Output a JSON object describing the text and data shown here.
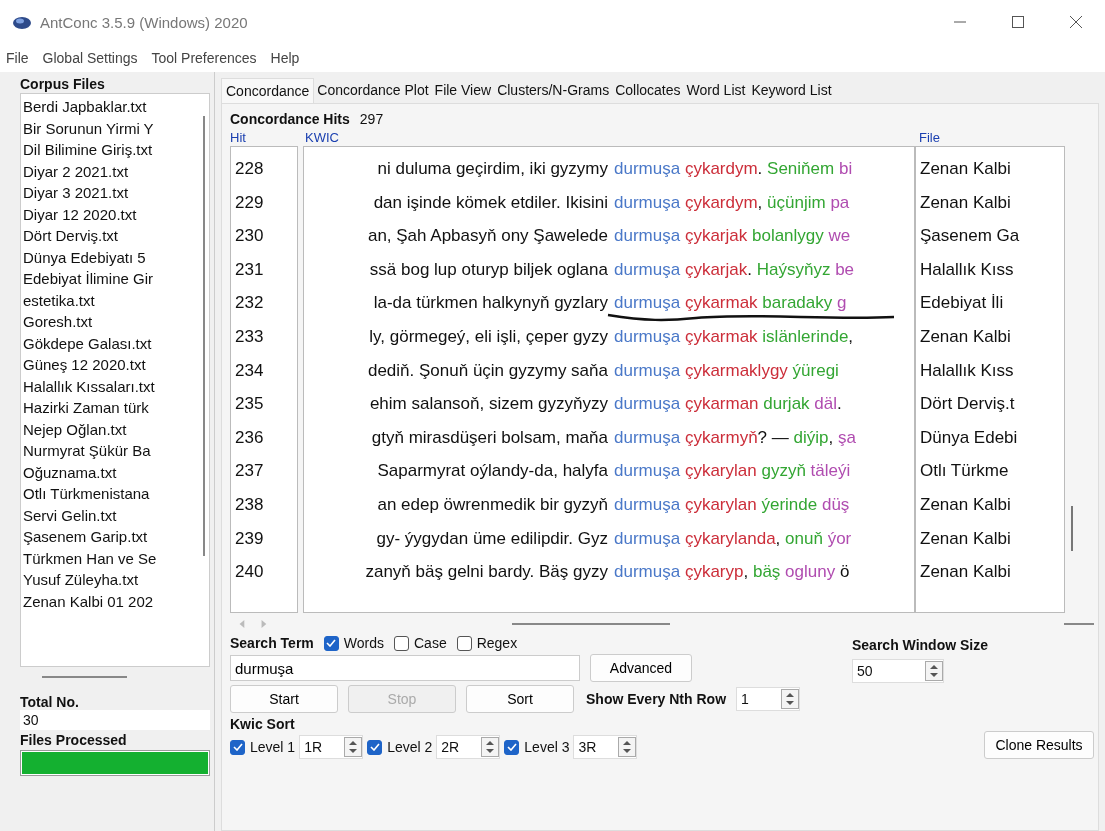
{
  "window": {
    "title": "AntConc 3.5.9 (Windows) 2020"
  },
  "menu": [
    "File",
    "Global Settings",
    "Tool Preferences",
    "Help"
  ],
  "corpus_files": {
    "title": "Corpus Files",
    "items": [
      "Berdi Japbaklar.txt",
      "Bir Sorunun Yirmi Y",
      "Dil Bilimine Giriş.txt",
      "Diyar 2 2021.txt",
      "Diyar 3 2021.txt",
      "Diyar 12 2020.txt",
      "Dört Derviş.txt",
      "Dünya Edebiyatı 5",
      "Edebiyat İlimine Gir",
      "estetika.txt",
      "Goresh.txt",
      "Gökdepe Galası.txt",
      "Güneş 12 2020.txt",
      "Halallık Kıssaları.txt",
      "Hazirki Zaman türk",
      "Nejep Oğlan.txt",
      "Nurmyrat Şükür Ba",
      "Oğuznama.txt",
      "Otlı Türkmenistana",
      "Servi Gelin.txt",
      "Şasenem Garip.txt",
      "Türkmen Han ve Se",
      "Yusuf Züleyha.txt",
      "Zenan Kalbi 01 202"
    ]
  },
  "total": {
    "label": "Total No.",
    "value": "30"
  },
  "files_processed": {
    "label": "Files Processed",
    "level": 1
  },
  "tabs": [
    {
      "label": "Concordance",
      "selected": true
    },
    {
      "label": "Concordance Plot",
      "selected": false
    },
    {
      "label": "File View",
      "selected": false
    },
    {
      "label": "Clusters/N-Grams",
      "selected": false
    },
    {
      "label": "Collocates",
      "selected": false
    },
    {
      "label": "Word List",
      "selected": false
    },
    {
      "label": "Keyword List",
      "selected": false
    }
  ],
  "hits": {
    "label": "Concordance Hits",
    "value": "297"
  },
  "columns": [
    "Hit",
    "KWIC",
    "File"
  ],
  "rows": [
    {
      "hit": "228",
      "left": "ni duluma geçirdim, iki gyzymy",
      "right": [
        {
          "text": "durmuşa",
          "kind": "key"
        },
        {
          "text": "çykardym",
          "kind": "r1"
        },
        {
          "text": ".",
          "kind": "punct"
        },
        {
          "text": "Seniňem",
          "kind": "r2"
        },
        {
          "text": "bi",
          "kind": "r3"
        }
      ],
      "file": "Zenan Kalbi",
      "underlined": false
    },
    {
      "hit": "229",
      "left": "dan işinde kömek etdiler. Ikisini",
      "right": [
        {
          "text": "durmuşa",
          "kind": "key"
        },
        {
          "text": "çykardym",
          "kind": "r1"
        },
        {
          "text": ",",
          "kind": "punct"
        },
        {
          "text": "üçünjim",
          "kind": "r2"
        },
        {
          "text": "pa",
          "kind": "r3"
        }
      ],
      "file": "Zenan Kalbi",
      "underlined": false
    },
    {
      "hit": "230",
      "left": "an, Şah Apbasyň ony Şawelede",
      "right": [
        {
          "text": "durmuşa",
          "kind": "key"
        },
        {
          "text": "çykarjak",
          "kind": "r1"
        },
        {
          "text": "bolanlygy",
          "kind": "r2"
        },
        {
          "text": "we",
          "kind": "r3"
        }
      ],
      "file": "Şasenem Ga",
      "underlined": false
    },
    {
      "hit": "231",
      "left": "ssä bog lup oturyp biljek oglana",
      "right": [
        {
          "text": "durmuşa",
          "kind": "key"
        },
        {
          "text": "çykarjak",
          "kind": "r1"
        },
        {
          "text": ".",
          "kind": "punct"
        },
        {
          "text": "Haýsyňyz",
          "kind": "r2"
        },
        {
          "text": "be",
          "kind": "r3"
        }
      ],
      "file": "Halallık Kıss",
      "underlined": false
    },
    {
      "hit": "232",
      "left": "la-da türkmen halkynyň gyzlary",
      "right": [
        {
          "text": "durmuşa",
          "kind": "key"
        },
        {
          "text": "çykarmak",
          "kind": "r1"
        },
        {
          "text": "baradaky",
          "kind": "r2"
        },
        {
          "text": "g",
          "kind": "r3"
        }
      ],
      "file": "Edebiyat İli",
      "underlined": true
    },
    {
      "hit": "233",
      "left": "ly, görmegeý, eli işli, çeper gyzy",
      "right": [
        {
          "text": "durmuşa",
          "kind": "key"
        },
        {
          "text": "çykarmak",
          "kind": "r1"
        },
        {
          "text": "islänlerinde",
          "kind": "r2"
        },
        {
          "text": ",",
          "kind": "punct"
        }
      ],
      "file": "Zenan Kalbi",
      "underlined": false
    },
    {
      "hit": "234",
      "left": "dediň. Şonuň üçin gyzymy saňa",
      "right": [
        {
          "text": "durmuşa",
          "kind": "key"
        },
        {
          "text": "çykarmaklygy",
          "kind": "r1"
        },
        {
          "text": "ýüregi",
          "kind": "r2"
        }
      ],
      "file": "Halallık Kıss",
      "underlined": false
    },
    {
      "hit": "235",
      "left": "ehim salansoň, sizem gyzyňyzy",
      "right": [
        {
          "text": "durmuşa",
          "kind": "key"
        },
        {
          "text": "çykarman",
          "kind": "r1"
        },
        {
          "text": "durjak",
          "kind": "r2"
        },
        {
          "text": "däl",
          "kind": "r3"
        },
        {
          "text": ".",
          "kind": "punct"
        }
      ],
      "file": "Dört Derviş.t",
      "underlined": false
    },
    {
      "hit": "236",
      "left": "gtyň mirasdüşeri bolsam, maňa",
      "right": [
        {
          "text": "durmuşa",
          "kind": "key"
        },
        {
          "text": "çykarmyň",
          "kind": "r1"
        },
        {
          "text": "?",
          "kind": "punct"
        },
        {
          "text": "—",
          "kind": "plain"
        },
        {
          "text": "diýip",
          "kind": "r2"
        },
        {
          "text": ",",
          "kind": "punct"
        },
        {
          "text": "şa",
          "kind": "r3"
        }
      ],
      "file": "Dünya Edebi",
      "underlined": false
    },
    {
      "hit": "237",
      "left": "Saparmyrat oýlandy-da, halyfa",
      "right": [
        {
          "text": "durmuşa",
          "kind": "key"
        },
        {
          "text": "çykarylan",
          "kind": "r1"
        },
        {
          "text": "gyzyň",
          "kind": "r2"
        },
        {
          "text": "täleýi",
          "kind": "r3"
        }
      ],
      "file": "Otlı Türkme",
      "underlined": false
    },
    {
      "hit": "238",
      "left": "an edep öwrenmedik bir gyzyň",
      "right": [
        {
          "text": "durmuşa",
          "kind": "key"
        },
        {
          "text": "çykarylan",
          "kind": "r1"
        },
        {
          "text": "ýerinde",
          "kind": "r2"
        },
        {
          "text": "düş",
          "kind": "r3"
        }
      ],
      "file": "Zenan Kalbi",
      "underlined": false
    },
    {
      "hit": "239",
      "left": "gy- ýygydan üme edilipdir. Gyz",
      "right": [
        {
          "text": "durmuşa",
          "kind": "key"
        },
        {
          "text": "çykarylanda",
          "kind": "r1"
        },
        {
          "text": ",",
          "kind": "punct"
        },
        {
          "text": "onuň",
          "kind": "r2"
        },
        {
          "text": "ýor",
          "kind": "r3"
        }
      ],
      "file": "Zenan Kalbi",
      "underlined": false
    },
    {
      "hit": "240",
      "left": "zanyň bäş gelni bardy. Bäş gyzy",
      "right": [
        {
          "text": "durmuşa",
          "kind": "key"
        },
        {
          "text": "çykaryp",
          "kind": "r1"
        },
        {
          "text": ",",
          "kind": "punct"
        },
        {
          "text": "bäş",
          "kind": "r2"
        },
        {
          "text": "ogluny",
          "kind": "r3"
        },
        {
          "text": "ö",
          "kind": "plain"
        }
      ],
      "file": "Zenan Kalbi",
      "underlined": false
    }
  ],
  "search": {
    "label": "Search Term",
    "options": [
      {
        "label": "Words",
        "checked": true
      },
      {
        "label": "Case",
        "checked": false
      },
      {
        "label": "Regex",
        "checked": false
      }
    ],
    "value": "durmuşa",
    "advanced": "Advanced"
  },
  "buttons": [
    {
      "label": "Start",
      "disabled": false
    },
    {
      "label": "Stop",
      "disabled": true
    },
    {
      "label": "Sort",
      "disabled": false
    }
  ],
  "nth_row": {
    "label": "Show Every Nth Row",
    "value": "1"
  },
  "window_size": {
    "label": "Search Window Size",
    "value": "50"
  },
  "kwic_sort": {
    "label": "Kwic Sort",
    "levels": [
      {
        "label": "Level 1",
        "checked": true,
        "value": "1R"
      },
      {
        "label": "Level 2",
        "checked": true,
        "value": "2R"
      },
      {
        "label": "Level 3",
        "checked": true,
        "value": "3R"
      }
    ]
  },
  "clone": "Clone Results"
}
